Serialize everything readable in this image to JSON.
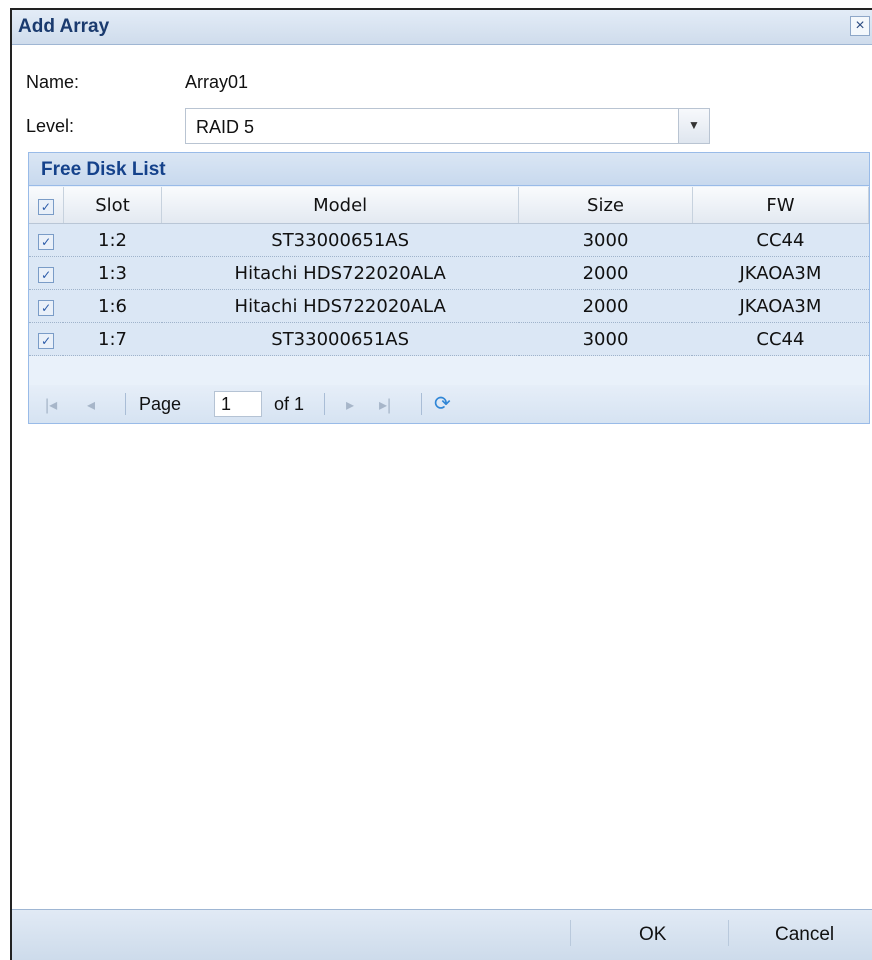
{
  "dialog": {
    "title": "Add Array"
  },
  "form": {
    "name_label": "Name:",
    "name_value": "Array01",
    "level_label": "Level:",
    "level_value": "RAID 5"
  },
  "panel": {
    "title": "Free Disk List",
    "columns": [
      "Slot",
      "Model",
      "Size",
      "FW"
    ],
    "rows": [
      {
        "checked": true,
        "slot": "1:2",
        "model": "ST33000651AS",
        "size": "3000",
        "fw": "CC44"
      },
      {
        "checked": true,
        "slot": "1:3",
        "model": "Hitachi HDS722020ALA",
        "size": "2000",
        "fw": "JKAOA3M"
      },
      {
        "checked": true,
        "slot": "1:6",
        "model": "Hitachi HDS722020ALA",
        "size": "2000",
        "fw": "JKAOA3M"
      },
      {
        "checked": true,
        "slot": "1:7",
        "model": "ST33000651AS",
        "size": "3000",
        "fw": "CC44"
      }
    ]
  },
  "pager": {
    "page_label": "Page",
    "page_value": "1",
    "of_label": "of 1"
  },
  "footer": {
    "ok_label": "OK",
    "cancel_label": "Cancel"
  },
  "icons": {
    "close": "close-icon",
    "dropdown": "chevron-down-icon",
    "first": "first-page-icon",
    "prev": "prev-page-icon",
    "next": "next-page-icon",
    "last": "last-page-icon",
    "refresh": "refresh-icon"
  },
  "colors": {
    "header_text": "#15428b",
    "panel_bg": "#dbe7f5"
  }
}
